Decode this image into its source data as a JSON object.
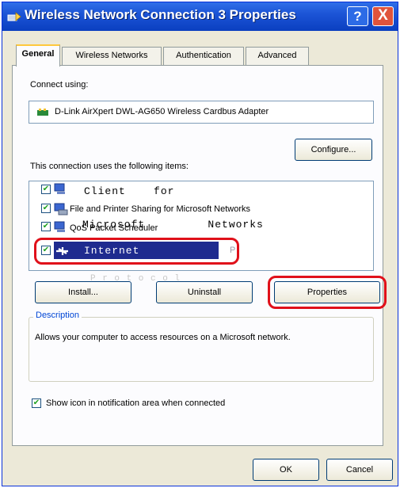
{
  "window": {
    "title": "Wireless Network Connection 3 Properties",
    "help_label": "?",
    "close_label": "X"
  },
  "tabs": [
    {
      "label": "General",
      "active": true
    },
    {
      "label": "Wireless Networks",
      "active": false
    },
    {
      "label": "Authentication",
      "active": false
    },
    {
      "label": "Advanced",
      "active": false
    }
  ],
  "connect_using": {
    "label": "Connect using:",
    "adapter": "D-Link AirXpert DWL-AG650 Wireless Cardbus Adapter",
    "configure_label": "Configure..."
  },
  "items": {
    "label": "This connection uses the following items:",
    "list": [
      {
        "label": "Client for Microsoft Networks",
        "checked": true,
        "icon": "network-client-icon"
      },
      {
        "label": "File and Printer Sharing for Microsoft Networks",
        "checked": true,
        "icon": "file-printer-sharing-icon"
      },
      {
        "label": "QoS Packet Scheduler",
        "checked": true,
        "icon": "qos-scheduler-icon"
      },
      {
        "label": "Internet Protocol (TCP/IP)",
        "checked": true,
        "selected": true,
        "icon": "protocol-icon"
      }
    ],
    "overlay": {
      "client": "Client    for",
      "microsoft_networks": "Microsoft         Networks",
      "internet": "Internet"
    }
  },
  "buttons": {
    "install": "Install...",
    "uninstall": "Uninstall",
    "properties": "Properties"
  },
  "description": {
    "legend": "Description",
    "text": "Allows your computer to access resources on a Microsoft network."
  },
  "show_icon": {
    "label": "Show icon in notification area when connected",
    "checked": true
  },
  "footer": {
    "ok": "OK",
    "cancel": "Cancel"
  },
  "colors": {
    "titlebar": "#1c54d6",
    "highlight": "#e0101a",
    "selection": "#1f2b8f"
  }
}
